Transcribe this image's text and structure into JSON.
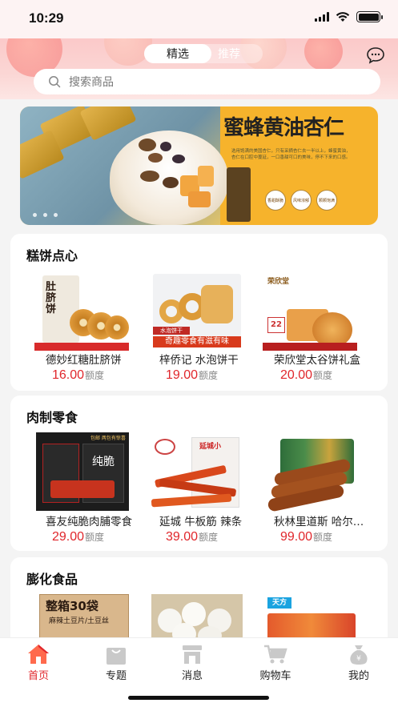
{
  "status": {
    "time": "10:29"
  },
  "header": {
    "tabs": [
      {
        "label": "精选"
      },
      {
        "label": "推荐"
      }
    ],
    "message_icon": "chat-bubble-icon"
  },
  "search": {
    "placeholder": "搜索商品",
    "icon": "search-icon"
  },
  "banner": {
    "title": "蜜蜂黄油杏仁",
    "description": "选用饱满的美国杏仁，只有采摘杏仁去一半以上，蜂蜜黄油，杏仁在口腔中蔓延，一口香甜可口的美味，停不下来的口感。",
    "badges": [
      "香甜酥脆",
      "风味浓郁",
      "颗颗饱满"
    ],
    "page_dots": 3
  },
  "sections": [
    {
      "title": "糕饼点心",
      "products": [
        {
          "name": "德妙红糖肚脐饼",
          "price": "16.00",
          "unit": "额度"
        },
        {
          "name": "梓侨记 水泡饼干",
          "price": "19.00",
          "unit": "额度"
        },
        {
          "name": "荣欣堂太谷饼礼盒",
          "price": "20.00",
          "unit": "额度"
        }
      ]
    },
    {
      "title": "肉制零食",
      "products": [
        {
          "name": "喜友纯脆肉脯零食",
          "price": "29.00",
          "unit": "额度"
        },
        {
          "name": "延城 牛板筋 辣条",
          "price": "39.00",
          "unit": "额度"
        },
        {
          "name": "秋林里道斯 哈尔滨红肠",
          "price": "99.00",
          "unit": "额度"
        }
      ]
    },
    {
      "title": "膨化食品",
      "products": [
        {
          "label_text": "整箱30袋",
          "sub_text": "麻辣土豆片/土豆丝"
        },
        {},
        {
          "label_text": "天方"
        }
      ]
    }
  ],
  "product_images": {
    "s0p0_text": "肚脐饼",
    "s0p1_text": "奇趣零食有滋有味",
    "s0p1_tag": "水泡饼干",
    "s0p2_text": "荣欣堂",
    "s0p2_num": "22",
    "s1p0_text": "纯脆",
    "s1p0_top": "包邮 两包有惊喜",
    "s1p1_text": "延城小"
  },
  "tabbar": [
    {
      "label": "首页",
      "icon": "home-icon",
      "active": true
    },
    {
      "label": "专题",
      "icon": "shopping-bag-icon",
      "active": false
    },
    {
      "label": "消息",
      "icon": "store-icon",
      "active": false
    },
    {
      "label": "购物车",
      "icon": "cart-icon",
      "active": false
    },
    {
      "label": "我的",
      "icon": "money-bag-icon",
      "active": false
    }
  ],
  "colors": {
    "accent": "#e0262b",
    "header_bg": "#fbc9c9",
    "banner_bg": "#f6b32c"
  }
}
